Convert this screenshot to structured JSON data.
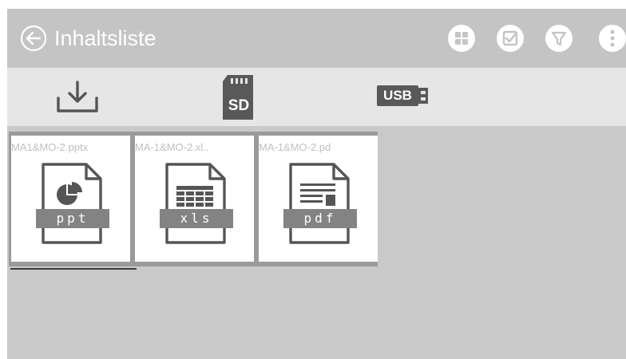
{
  "header": {
    "title": "Inhaltsliste",
    "back_icon": "back-arrow-icon",
    "actions": [
      {
        "name": "grid-view-button",
        "icon": "grid-icon"
      },
      {
        "name": "select-button",
        "icon": "checkbox-icon"
      },
      {
        "name": "filter-button",
        "icon": "filter-icon"
      },
      {
        "name": "more-button",
        "icon": "more-vert-icon"
      }
    ]
  },
  "sources": [
    {
      "name": "source-download",
      "icon": "download-icon",
      "label": ""
    },
    {
      "name": "source-sd",
      "icon": "sd-card-icon",
      "label": "SD"
    },
    {
      "name": "source-usb",
      "icon": "usb-icon",
      "label": "USB"
    }
  ],
  "files": [
    {
      "name": "MA1&MO-2.pptx",
      "ext": "ppt",
      "icon": "pie-chart-icon"
    },
    {
      "name": "MA-1&MO-2.xl..",
      "ext": "xls",
      "icon": "spreadsheet-icon"
    },
    {
      "name": "MA-1&MO-2.pd",
      "ext": "pdf",
      "icon": "document-lines-icon"
    }
  ],
  "colors": {
    "titlebar": "#c4c4c4",
    "sourcebar": "#e6e6e6",
    "content": "#c9c9c9",
    "icon_dark": "#555555",
    "badge": "#838383"
  }
}
